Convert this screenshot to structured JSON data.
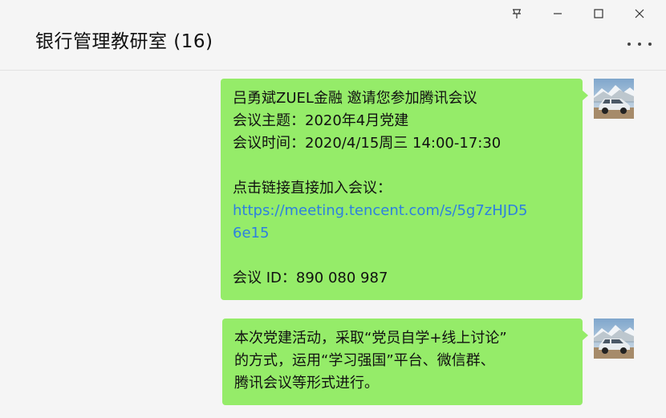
{
  "window": {
    "title": "银行管理教研室 (16)",
    "controls": {
      "pin": "pin-icon",
      "minimize": "minimize-icon",
      "maximize": "maximize-icon",
      "close": "close-icon"
    }
  },
  "messages": [
    {
      "sender": "self",
      "avatar": "suv-car-photo",
      "lines": {
        "l1": "吕勇斌ZUEL金融 邀请您参加腾讯会议",
        "l2": "会议主题：2020年4月党建",
        "l3": "会议时间：2020/4/15周三 14:00-17:30",
        "l4": "点击链接直接加入会议：",
        "link_part1": "https://meeting.tencent.com/s/5g7zHJD5",
        "link_part2": "6e15",
        "l5": "会议 ID：890 080 987"
      }
    },
    {
      "sender": "self",
      "avatar": "suv-car-photo",
      "lines": {
        "l1": "本次党建活动，采取“党员自学+线上讨论”",
        "l2": "的方式，运用“学习强国”平台、微信群、",
        "l3": "腾讯会议等形式进行。"
      }
    }
  ],
  "colors": {
    "bubble": "#95ec69",
    "link": "#2d7fe0",
    "background": "#f5f5f5"
  }
}
